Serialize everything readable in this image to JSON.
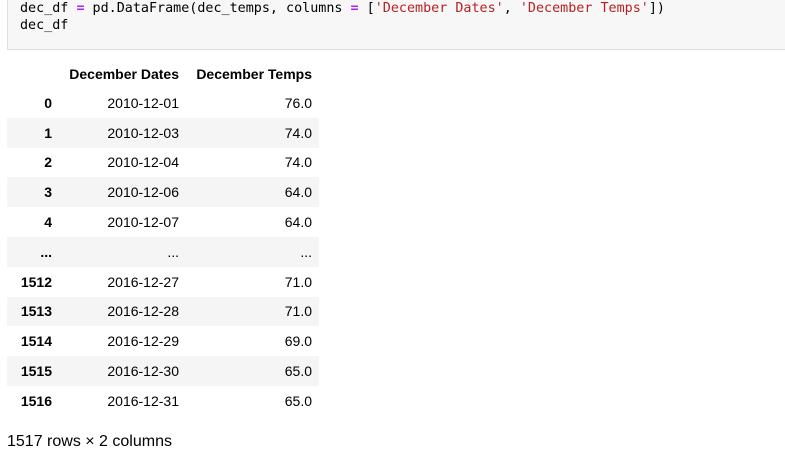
{
  "code": {
    "line1": {
      "var": "dec_df ",
      "eq": "=",
      "call": " pd.DataFrame(dec_temps, columns ",
      "eq2": "=",
      "open": " [",
      "s1": "'December Dates'",
      "comma": ", ",
      "s2": "'December Temps'",
      "close": "])"
    },
    "line2": "dec_df"
  },
  "table": {
    "columns": [
      "December Dates",
      "December Temps"
    ],
    "rows": [
      {
        "index": "0",
        "date": "2010-12-01",
        "temp": "76.0"
      },
      {
        "index": "1",
        "date": "2010-12-03",
        "temp": "74.0"
      },
      {
        "index": "2",
        "date": "2010-12-04",
        "temp": "74.0"
      },
      {
        "index": "3",
        "date": "2010-12-06",
        "temp": "64.0"
      },
      {
        "index": "4",
        "date": "2010-12-07",
        "temp": "64.0"
      },
      {
        "index": "...",
        "date": "...",
        "temp": "..."
      },
      {
        "index": "1512",
        "date": "2016-12-27",
        "temp": "71.0"
      },
      {
        "index": "1513",
        "date": "2016-12-28",
        "temp": "71.0"
      },
      {
        "index": "1514",
        "date": "2016-12-29",
        "temp": "69.0"
      },
      {
        "index": "1515",
        "date": "2016-12-30",
        "temp": "65.0"
      },
      {
        "index": "1516",
        "date": "2016-12-31",
        "temp": "65.0"
      }
    ],
    "shape": "1517 rows × 2 columns"
  },
  "colors": {
    "code_bg": "#f7f7f7",
    "operator": "#aa22ff",
    "string": "#ba2121",
    "stripe": "#f5f5f5"
  }
}
